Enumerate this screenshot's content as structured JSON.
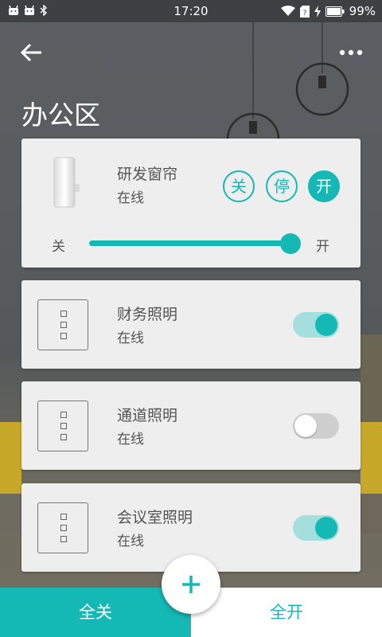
{
  "status_bar": {
    "time": "17:20",
    "battery": "99%"
  },
  "header": {
    "title": "办公区"
  },
  "devices": [
    {
      "name": "研发窗帘",
      "status": "在线",
      "controls": [
        "关",
        "停",
        "开"
      ],
      "slider_min_label": "关",
      "slider_max_label": "开",
      "position_percent": 100
    },
    {
      "name": "财务照明",
      "status": "在线",
      "on": true
    },
    {
      "name": "通道照明",
      "status": "在线",
      "on": false
    },
    {
      "name": "会议室照明",
      "status": "在线",
      "on": true
    }
  ],
  "bottom_bar": {
    "all_off": "全关",
    "all_on": "全开",
    "add_icon": "plus-icon"
  },
  "colors": {
    "accent": "#14b8b5",
    "accent_light": "#a4dfde",
    "card_bg": "#eeeeee"
  }
}
